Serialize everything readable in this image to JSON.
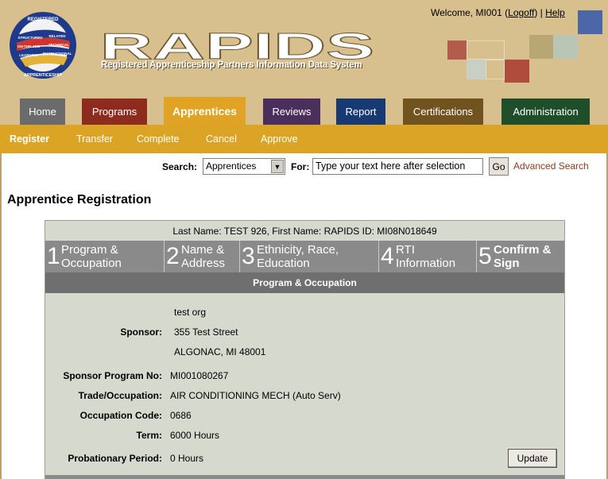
{
  "header": {
    "brand_title": "RAPIDS",
    "brand_subtitle": "Registered Apprenticeship Partners Information Data System",
    "logo_text": {
      "top": "REGISTERED",
      "bottom": "APPRENTICESHIP",
      "band1": "STRUCTURED",
      "band2": "ON-THE-JOB",
      "band3": "LEARNING",
      "band4": "RELATED",
      "band5": "TECHNICAL",
      "band6": "INSTRUCTION"
    },
    "welcome_prefix": "Welcome, MI001 (",
    "logoff_label": "Logoff",
    "welcome_mid": ") |",
    "help_label": "Help"
  },
  "tabs": [
    {
      "label": "Home",
      "color": "#6b6b6b"
    },
    {
      "label": "Programs",
      "color": "#8e2b1f"
    },
    {
      "label": "Apprentices",
      "color": "#e0a323"
    },
    {
      "label": "Reviews",
      "color": "#4a2e5c"
    },
    {
      "label": "Report",
      "color": "#173a75"
    },
    {
      "label": "Certifications",
      "color": "#715320"
    },
    {
      "label": "Administration",
      "color": "#1e4e2a"
    }
  ],
  "subnav": [
    "Register",
    "Transfer",
    "Complete",
    "Cancel",
    "Approve"
  ],
  "search": {
    "label": "Search:",
    "selected": "Apprentices",
    "for_label": "For:",
    "value": "Type your text here after selection",
    "go_label": "Go",
    "advanced_label": "Advanced Search"
  },
  "page_title": "Apprentice Registration",
  "apprentice": {
    "name_line": "Last Name: TEST 926,   First Name:  RAPIDS    ID: MI08N018649"
  },
  "steps": [
    {
      "num": "1",
      "line1": "Program &",
      "line2": "Occupation"
    },
    {
      "num": "2",
      "line1": "Name &",
      "line2": "Address"
    },
    {
      "num": "3",
      "line1": "Ethnicity, Race,",
      "line2": "Education"
    },
    {
      "num": "4",
      "line1": "RTI",
      "line2": "Information"
    },
    {
      "num": "5",
      "line1": "Confirm &",
      "line2": "Sign"
    }
  ],
  "section_title": "Program & Occupation",
  "form": {
    "sponsor_label": "Sponsor:",
    "sponsor_name": "test org",
    "sponsor_street": "355 Test Street",
    "sponsor_city": "ALGONAC,   MI   48001",
    "program_no_label": "Sponsor Program No:",
    "program_no": "MI001080267",
    "trade_label": "Trade/Occupation:",
    "trade": "AIR CONDITIONING MECH (Auto Serv)",
    "occ_code_label": "Occupation Code:",
    "occ_code": "0686",
    "term_label": "Term:",
    "term": "6000 Hours",
    "probation_label": "Probationary Period:",
    "probation": "0 Hours",
    "update_label": "Update"
  }
}
